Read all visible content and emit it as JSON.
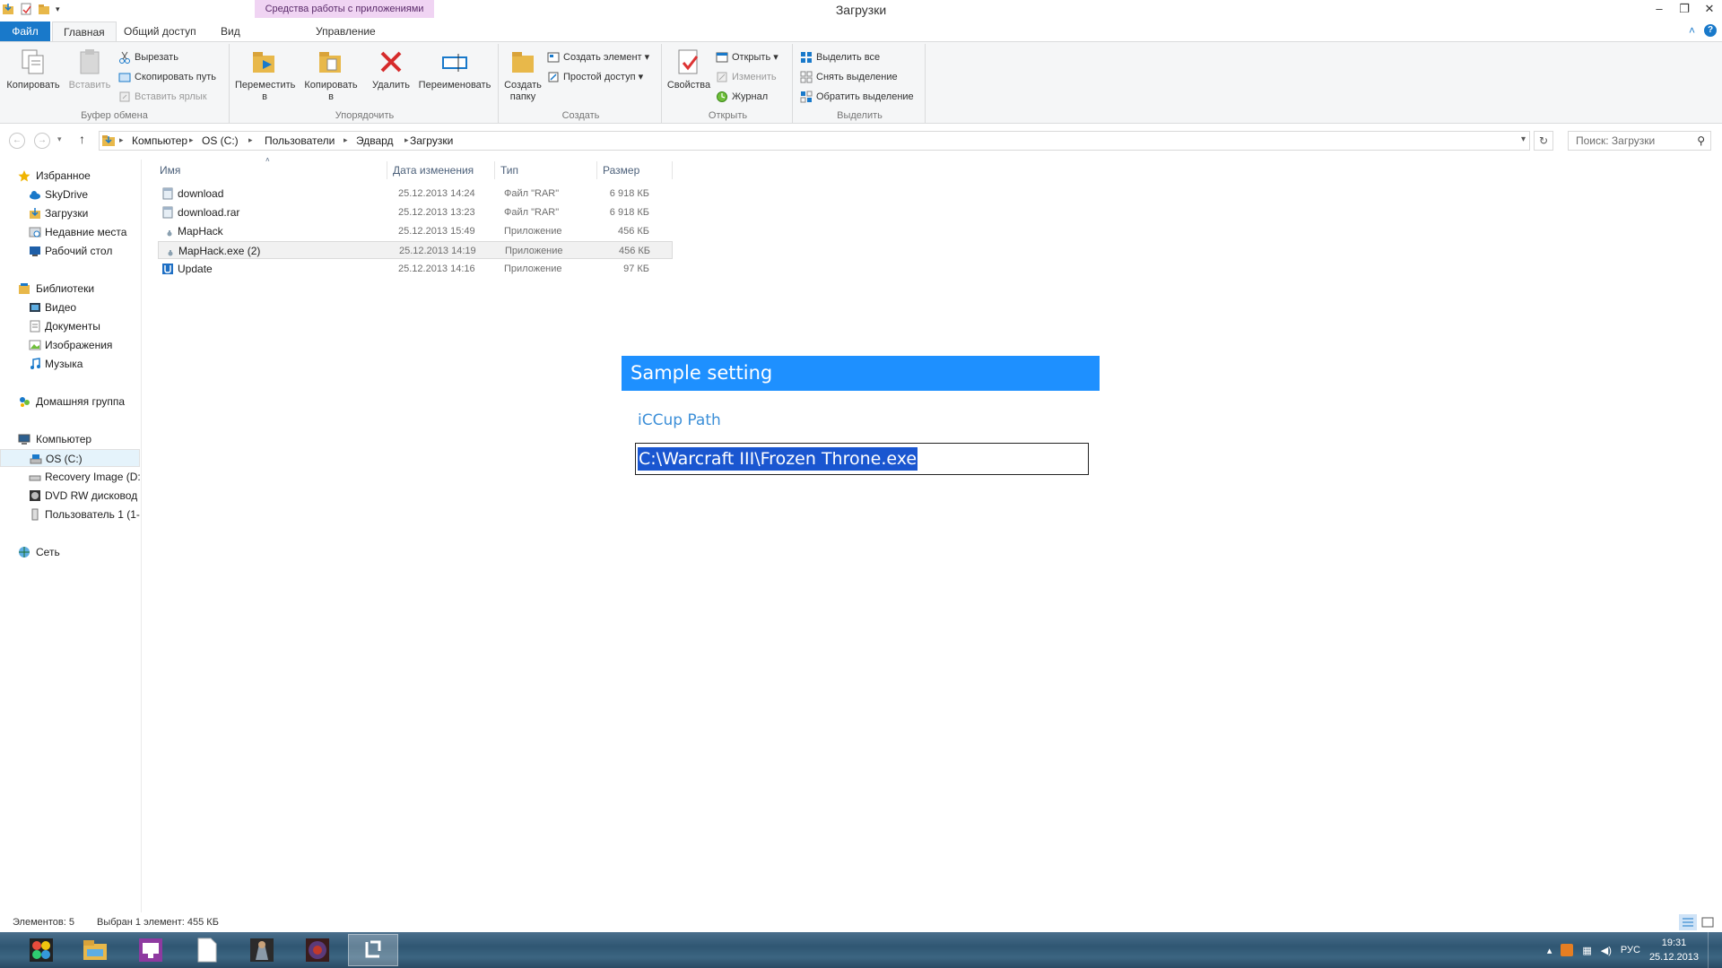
{
  "window": {
    "title": "Загрузки",
    "context_tab_group": "Средства работы с приложениями",
    "controls": [
      "–",
      "❐",
      "✕"
    ]
  },
  "tabs": {
    "file": "Файл",
    "home": "Главная",
    "share": "Общий доступ",
    "view": "Вид",
    "manage": "Управление"
  },
  "ribbon": {
    "clipboard": {
      "label": "Буфер обмена",
      "copy": "Копировать",
      "paste": "Вставить",
      "cut": "Вырезать",
      "copy_path": "Скопировать путь",
      "paste_shortcut": "Вставить ярлык"
    },
    "organize": {
      "label": "Упорядочить",
      "move_to": "Переместить в",
      "copy_to": "Копировать в",
      "delete": "Удалить",
      "rename": "Переименовать"
    },
    "new": {
      "label": "Создать",
      "new_folder": "Создать папку",
      "new_item": "Создать элемент",
      "easy_access": "Простой доступ"
    },
    "open": {
      "label": "Открыть",
      "properties": "Свойства",
      "open": "Открыть",
      "edit": "Изменить",
      "history": "Журнал"
    },
    "select": {
      "label": "Выделить",
      "select_all": "Выделить все",
      "select_none": "Снять выделение",
      "invert": "Обратить выделение"
    }
  },
  "address": {
    "crumbs": [
      "Компьютер",
      "OS (C:)",
      "Пользователи",
      "Эдвард",
      "Загрузки"
    ],
    "search_placeholder": "Поиск: Загрузки"
  },
  "nav": {
    "favorites": "Избранное",
    "skydrive": "SkyDrive",
    "downloads": "Загрузки",
    "recent": "Недавние места",
    "desktop": "Рабочий стол",
    "libraries": "Библиотеки",
    "video": "Видео",
    "documents": "Документы",
    "images": "Изображения",
    "music": "Музыка",
    "homegroup": "Домашняя группа",
    "computer": "Компьютер",
    "os_c": "OS (C:)",
    "recovery": "Recovery Image (D:)",
    "dvd": "DVD RW дисковод (",
    "user1": "Пользователь 1 (1-",
    "network": "Сеть"
  },
  "columns": {
    "name": "Имя",
    "date": "Дата изменения",
    "type": "Тип",
    "size": "Размер"
  },
  "files": [
    {
      "name": "download",
      "date": "25.12.2013 14:24",
      "type": "Файл \"RAR\"",
      "size": "6 918 КБ",
      "icon": "rar-icon"
    },
    {
      "name": "download.rar",
      "date": "25.12.2013 13:23",
      "type": "Файл \"RAR\"",
      "size": "6 918 КБ",
      "icon": "rar-icon"
    },
    {
      "name": "MapHack",
      "date": "25.12.2013 15:49",
      "type": "Приложение",
      "size": "456 КБ",
      "icon": "exe-icon"
    },
    {
      "name": "MapHack.exe (2)",
      "date": "25.12.2013 14:19",
      "type": "Приложение",
      "size": "456 КБ",
      "icon": "exe-icon"
    },
    {
      "name": "Update",
      "date": "25.12.2013 14:16",
      "type": "Приложение",
      "size": "97 КБ",
      "icon": "update-app-icon"
    }
  ],
  "dialog": {
    "title": "Sample setting",
    "field_label": "iCCup Path",
    "field_value": "C:\\Warcraft III\\Frozen Throne.exe"
  },
  "status": {
    "count": "Элементов: 5",
    "selection": "Выбран 1 элемент: 455 КБ"
  },
  "tray": {
    "lang": "РУС",
    "time": "19:31",
    "date": "25.12.2013"
  },
  "colors": {
    "accent": "#1979ca",
    "dialog_header": "#1e90ff",
    "dialog_label": "#3c8fd8",
    "selection": "#1a56d0"
  }
}
